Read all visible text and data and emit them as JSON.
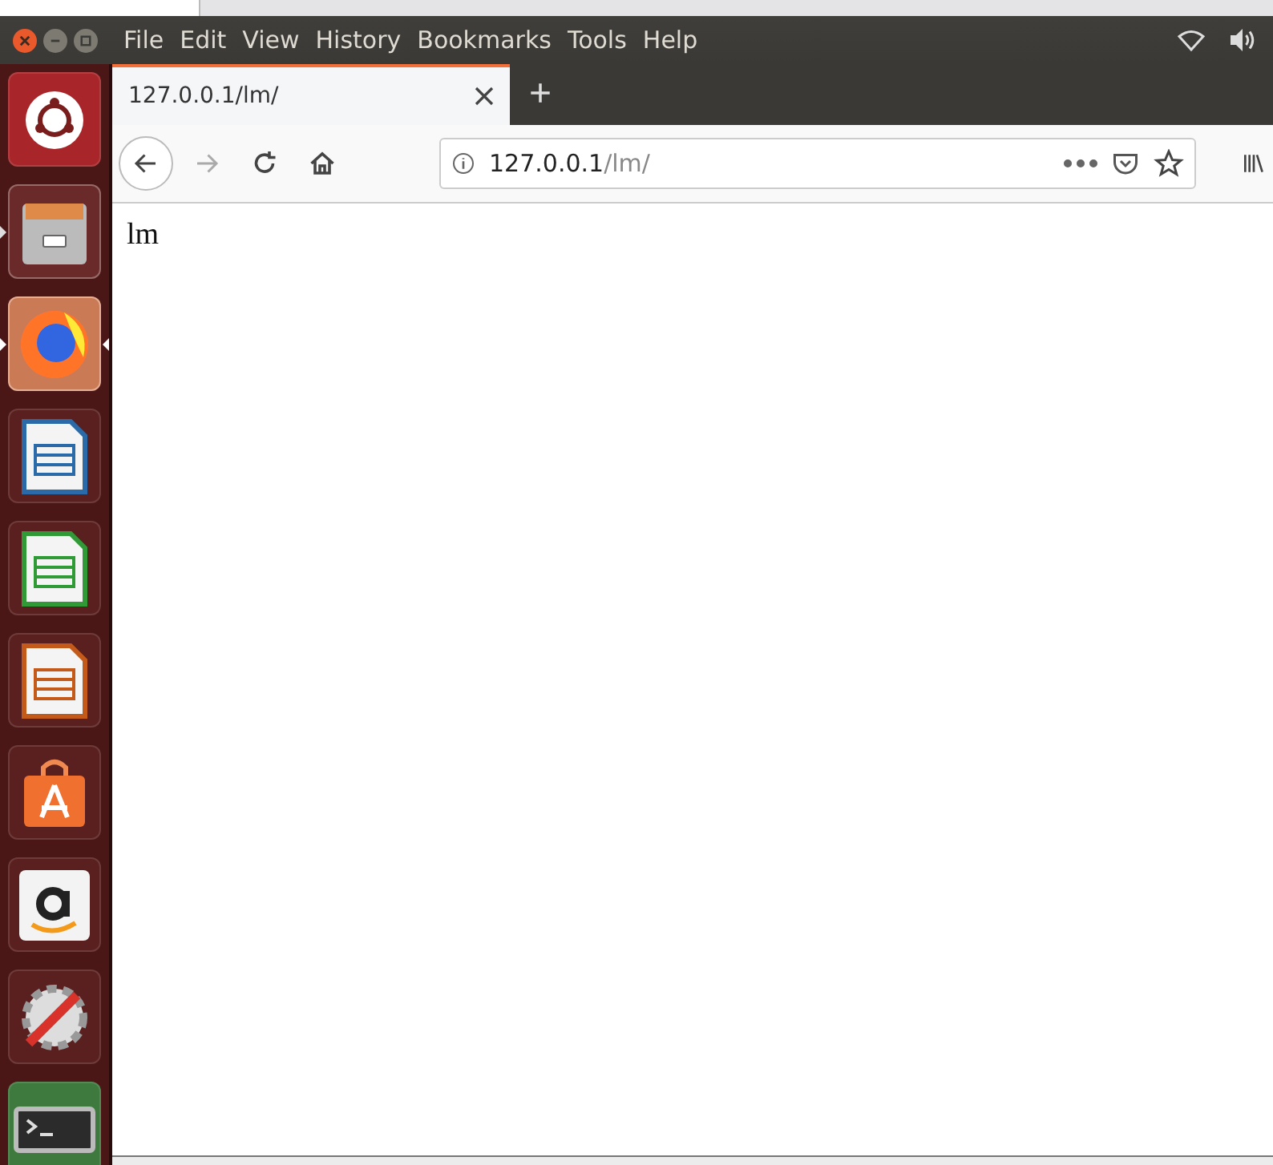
{
  "menu_bar": {
    "items": [
      "File",
      "Edit",
      "View",
      "History",
      "Bookmarks",
      "Tools",
      "Help"
    ]
  },
  "launcher": [
    {
      "kind": "ubuntu",
      "running": false,
      "focused": false
    },
    {
      "kind": "files",
      "running": true,
      "focused": false
    },
    {
      "kind": "firefox",
      "running": true,
      "focused": true
    },
    {
      "kind": "writer",
      "running": false,
      "focused": false
    },
    {
      "kind": "calc",
      "running": false,
      "focused": false
    },
    {
      "kind": "impress",
      "running": false,
      "focused": false
    },
    {
      "kind": "software",
      "running": false,
      "focused": false
    },
    {
      "kind": "amazon",
      "running": false,
      "focused": false
    },
    {
      "kind": "settings",
      "running": false,
      "focused": false
    },
    {
      "kind": "terminal",
      "running": false,
      "focused": false
    }
  ],
  "tabs": [
    {
      "label": "127.0.0.1/lm/",
      "selected": true
    },
    {
      "label": "+",
      "kind": "new"
    }
  ],
  "address_bar": {
    "host": "127.0.0.1",
    "path": "/lm/"
  },
  "page": {
    "text": "lm"
  }
}
